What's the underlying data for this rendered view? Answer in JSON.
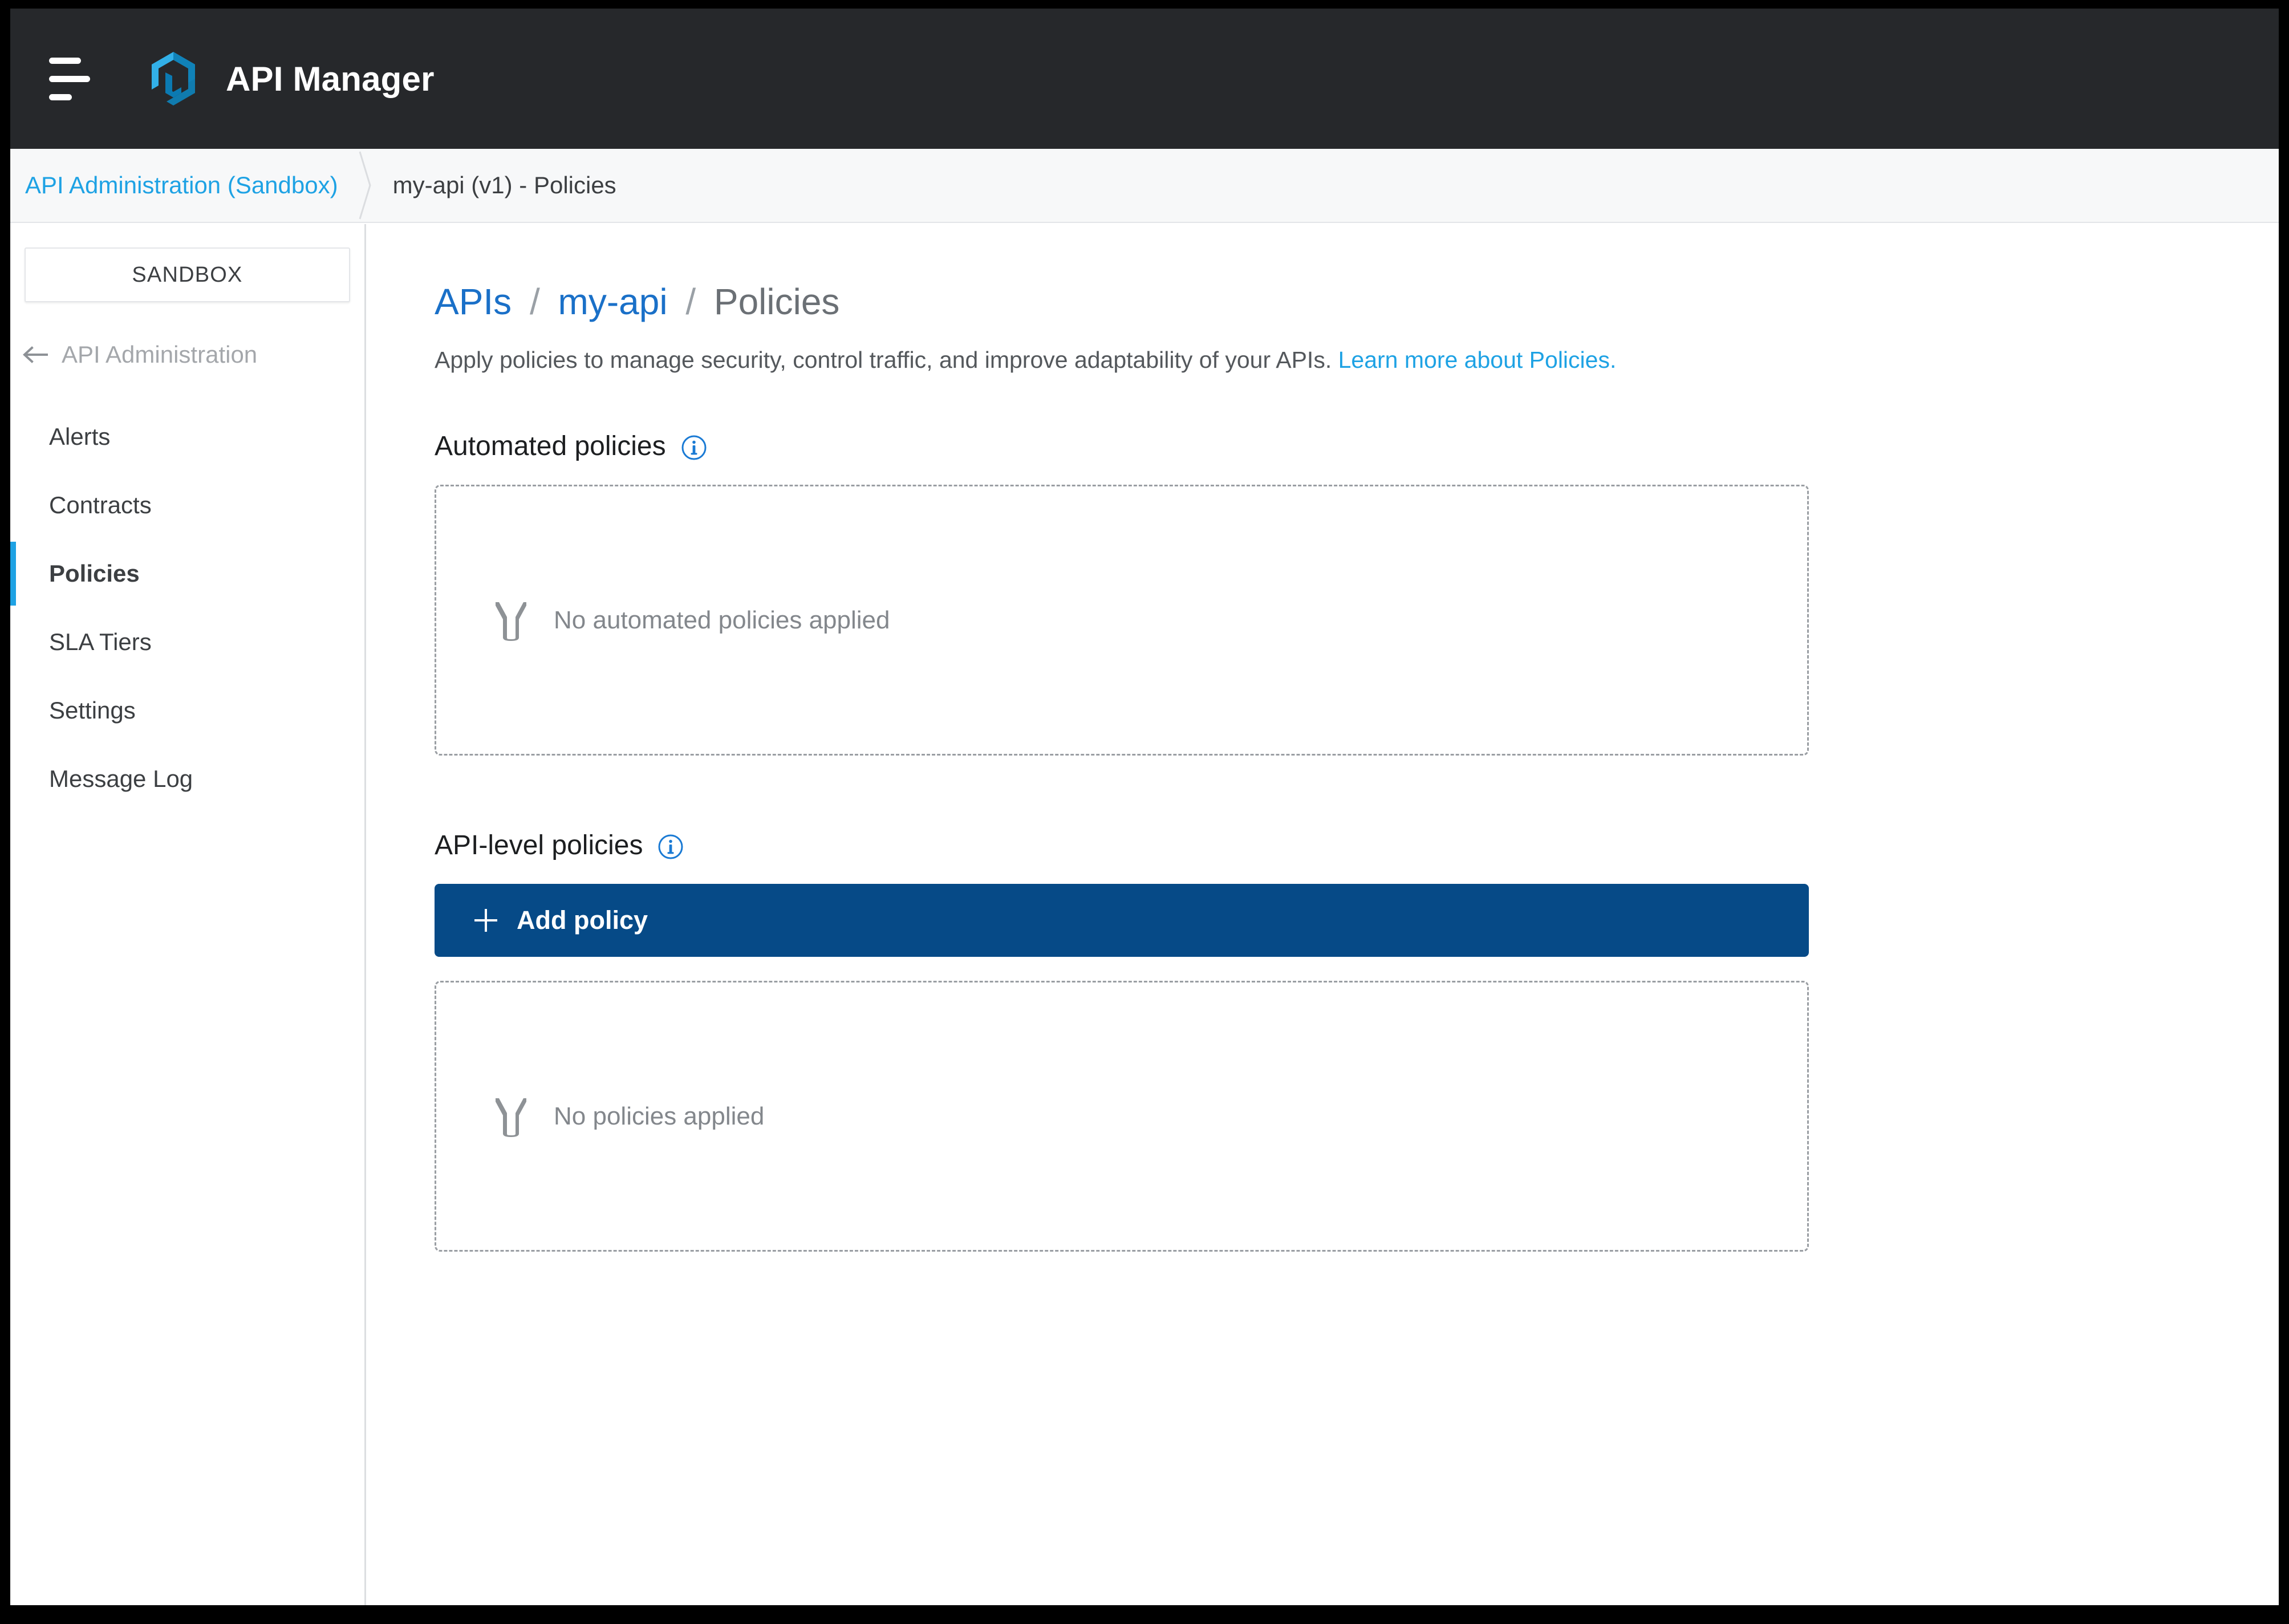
{
  "appbar": {
    "menu_icon": "hamburger-menu-icon",
    "logo_icon": "amplify-hexagon-logo",
    "title": "API Manager"
  },
  "breadcrumb": {
    "items": [
      {
        "label": "API Administration (Sandbox)",
        "link": true
      },
      {
        "label": "my-api (v1) - Policies",
        "link": false
      }
    ]
  },
  "sidebar": {
    "environment": "SANDBOX",
    "back": {
      "icon": "arrow-left-icon",
      "label": "API Administration"
    },
    "items": [
      {
        "label": "Alerts",
        "active": false
      },
      {
        "label": "Contracts",
        "active": false
      },
      {
        "label": "Policies",
        "active": true
      },
      {
        "label": "SLA Tiers",
        "active": false
      },
      {
        "label": "Settings",
        "active": false
      },
      {
        "label": "Message Log",
        "active": false
      }
    ]
  },
  "main": {
    "title": {
      "root": "APIs",
      "sep1": "/",
      "api": "my-api",
      "sep2": "/",
      "current": "Policies"
    },
    "description": {
      "text": "Apply policies to manage security, control traffic, and improve adaptability of your APIs.",
      "link_text": "Learn more about Policies."
    },
    "sections": [
      {
        "heading": "Automated policies",
        "info_icon": "info-circle-icon",
        "empty_icon": "policy-filter-icon",
        "empty_text": "No automated policies applied"
      },
      {
        "heading": "API-level policies",
        "info_icon": "info-circle-icon",
        "add_button": {
          "icon": "plus-icon",
          "label": "Add policy"
        },
        "empty_icon": "policy-filter-icon",
        "empty_text": "No policies applied"
      }
    ]
  },
  "colors": {
    "appbar_bg": "#26282b",
    "brand_blue": "#1ea2e4",
    "link_blue": "#1a70c8",
    "primary_button": "#064a87",
    "active_indicator": "#1ea2e4",
    "muted_text": "#83878c"
  }
}
